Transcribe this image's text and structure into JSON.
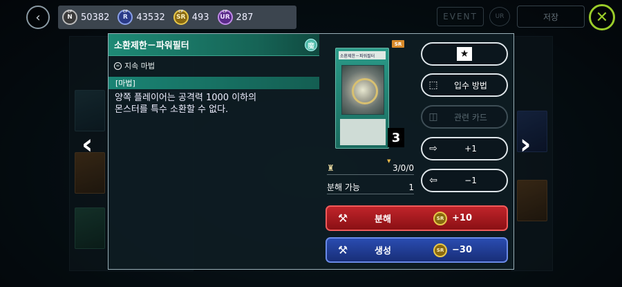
{
  "topbar": {
    "currencies": [
      {
        "tier": "N",
        "value": "50382"
      },
      {
        "tier": "R",
        "value": "43532"
      },
      {
        "tier": "SR",
        "value": "493"
      },
      {
        "tier": "UR",
        "value": "287"
      }
    ],
    "event_label": "EVENT",
    "ur_label": "UR",
    "save_label": "저장"
  },
  "card": {
    "name": "소환제한－파워필터",
    "attribute_symbol": "魔",
    "type_line": "지속 마법",
    "category": "[마법]",
    "description": "양쪽 플레이어는 공격력 1000 이하의\n몬스터를 특수 소환할 수 없다.",
    "image_title": "소환제한－파워필터",
    "rarity": "SR",
    "count": "3",
    "owned_value": "3/0/0",
    "dismantle_label": "분해 가능",
    "dismantle_count": "1"
  },
  "actions": {
    "obtain_label": "입수 방법",
    "related_label": "관련 카드",
    "add_label": "+1",
    "remove_label": "−1",
    "dismantle": {
      "label": "분해",
      "gem": "SR",
      "value": "+10"
    },
    "generate": {
      "label": "생성",
      "gem": "SR",
      "value": "−30"
    }
  }
}
